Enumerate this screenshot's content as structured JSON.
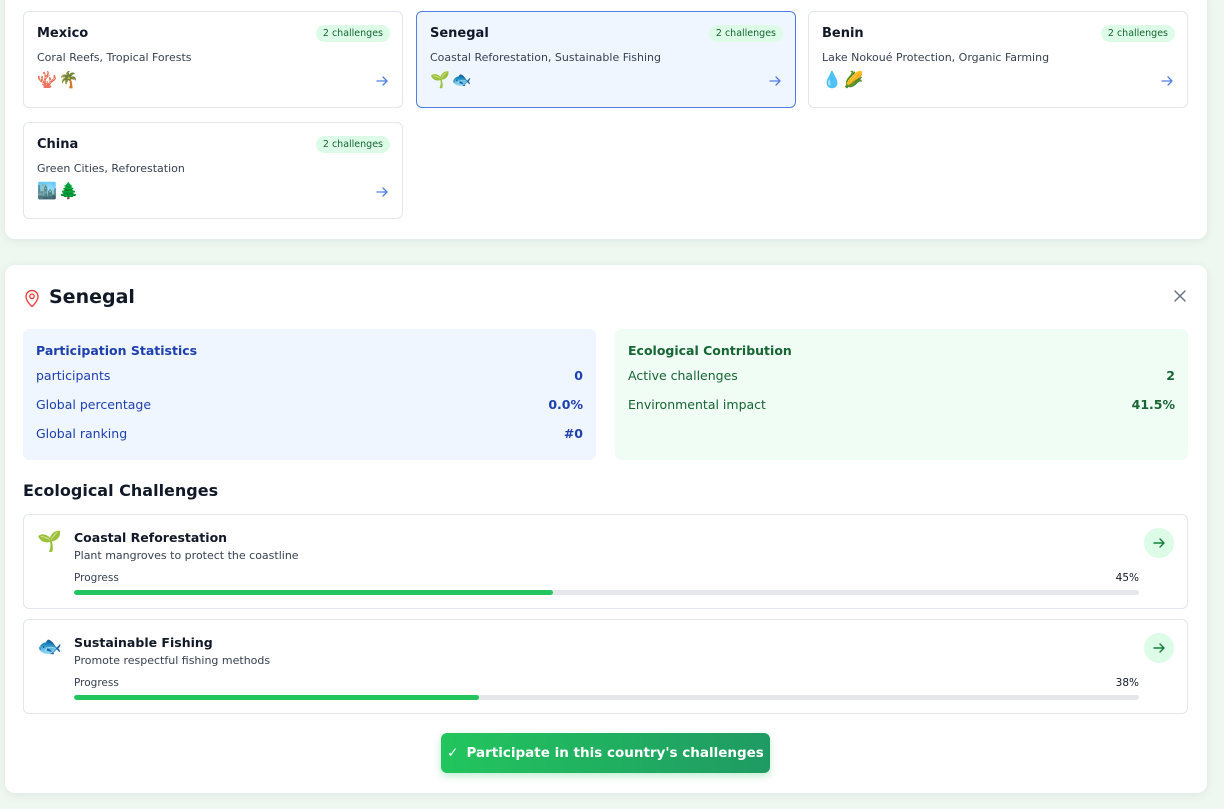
{
  "countries": [
    {
      "name": "Mexico",
      "badge": "2 challenges",
      "description": "Coral Reefs, Tropical Forests",
      "icons": "🪸🌴",
      "selected": false
    },
    {
      "name": "Senegal",
      "badge": "2 challenges",
      "description": "Coastal Reforestation, Sustainable Fishing",
      "icons": "🌱🐟",
      "selected": true
    },
    {
      "name": "Benin",
      "badge": "2 challenges",
      "description": "Lake Nokoué Protection, Organic Farming",
      "icons": "💧🌽",
      "selected": false
    },
    {
      "name": "China",
      "badge": "2 challenges",
      "description": "Green Cities, Reforestation",
      "icons": "🏙️🌲",
      "selected": false
    }
  ],
  "detail": {
    "title": "Senegal",
    "participation": {
      "heading": "Participation Statistics",
      "rows": [
        {
          "label": "participants",
          "value": "0"
        },
        {
          "label": "Global percentage",
          "value": "0.0%"
        },
        {
          "label": "Global ranking",
          "value": "#0"
        }
      ]
    },
    "ecology": {
      "heading": "Ecological Contribution",
      "rows": [
        {
          "label": "Active challenges",
          "value": "2"
        },
        {
          "label": "Environmental impact",
          "value": "41.5%"
        }
      ]
    },
    "challenges_heading": "Ecological Challenges",
    "challenges": [
      {
        "icon": "🌱",
        "title": "Coastal Reforestation",
        "description": "Plant mangroves to protect the coastline",
        "progress_label": "Progress",
        "progress_text": "45%",
        "progress": 45
      },
      {
        "icon": "🐟",
        "title": "Sustainable Fishing",
        "description": "Promote respectful fishing methods",
        "progress_label": "Progress",
        "progress_text": "38%",
        "progress": 38
      }
    ],
    "cta_label": "Participate in this country's challenges",
    "cta_check": "✓"
  },
  "colors": {
    "accent_green": "#22c55e",
    "accent_blue": "#4f7fe0",
    "pin_red": "#ef4444"
  }
}
